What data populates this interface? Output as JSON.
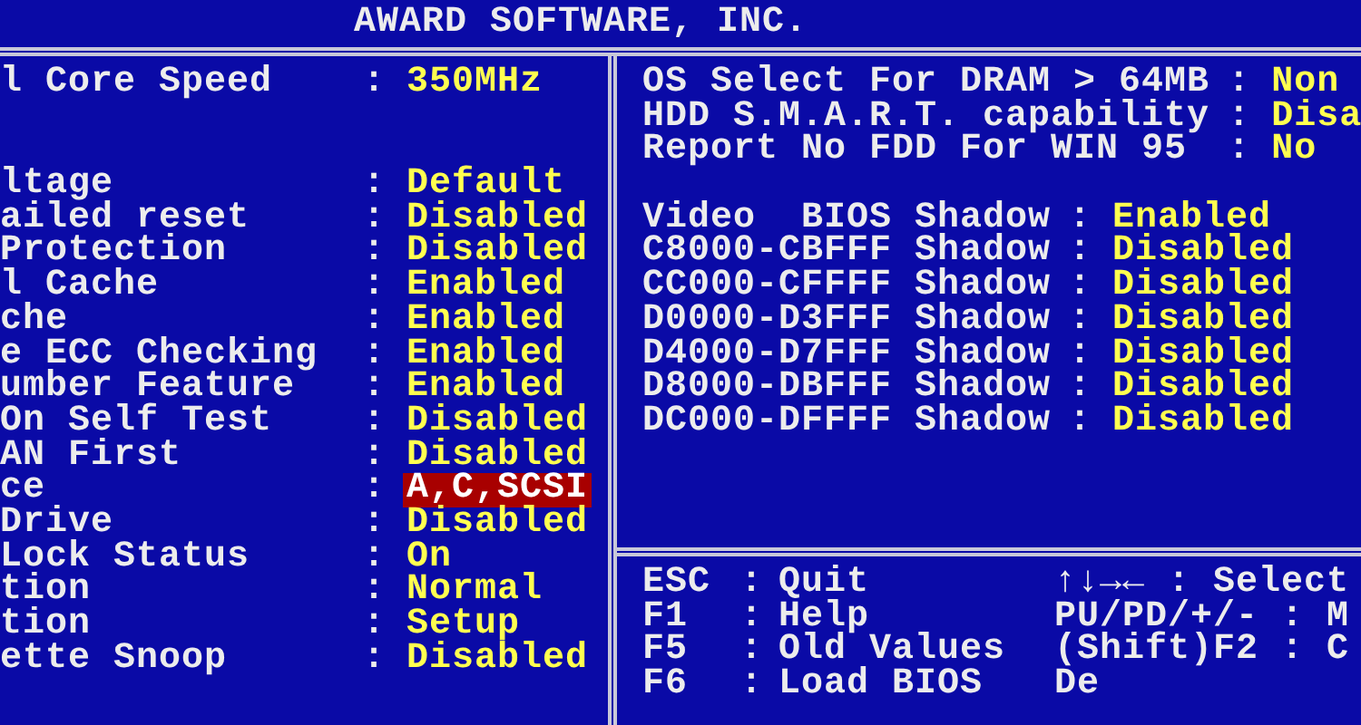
{
  "header": {
    "title": "AWARD SOFTWARE, INC."
  },
  "left_panel": {
    "separator": ":",
    "groups": [
      {
        "items": [
          {
            "label": "l Core Speed",
            "value": "350MHz",
            "selected": false
          }
        ]
      },
      {
        "items": [
          {
            "label": "ltage",
            "value": "Default",
            "selected": false
          },
          {
            "label": "ailed reset",
            "value": "Disabled",
            "selected": false
          },
          {
            "label": "Protection",
            "value": "Disabled",
            "selected": false
          },
          {
            "label": "l Cache",
            "value": "Enabled",
            "selected": false
          },
          {
            "label": "che",
            "value": "Enabled",
            "selected": false
          },
          {
            "label": "e ECC Checking",
            "value": "Enabled",
            "selected": false
          },
          {
            "label": "umber Feature",
            "value": "Enabled",
            "selected": false
          },
          {
            "label": "On Self Test",
            "value": "Disabled",
            "selected": false
          },
          {
            "label": "AN First",
            "value": "Disabled",
            "selected": false
          },
          {
            "label": "ce",
            "value": "A,C,SCSI",
            "selected": true
          },
          {
            "label": "Drive",
            "value": "Disabled",
            "selected": false
          },
          {
            "label": "Lock Status",
            "value": "On",
            "selected": false
          },
          {
            "label": "tion",
            "value": "Normal",
            "selected": false
          },
          {
            "label": "tion",
            "value": "Setup",
            "selected": false
          },
          {
            "label": "ette Snoop",
            "value": "Disabled",
            "selected": false
          }
        ]
      }
    ]
  },
  "right_panel": {
    "separator": ":",
    "groups": [
      {
        "items": [
          {
            "label": "OS Select For DRAM > 64MB",
            "value": "Non",
            "selected": false
          },
          {
            "label": "HDD S.M.A.R.T. capability",
            "value": "Disa",
            "selected": false
          },
          {
            "label": "Report No FDD For WIN 95",
            "value": "No",
            "selected": false
          }
        ]
      },
      {
        "items": [
          {
            "label": "Video  BIOS Shadow",
            "value": "Enabled",
            "selected": false
          },
          {
            "label": "C8000-CBFFF Shadow",
            "value": "Disabled",
            "selected": false
          },
          {
            "label": "CC000-CFFFF Shadow",
            "value": "Disabled",
            "selected": false
          },
          {
            "label": "D0000-D3FFF Shadow",
            "value": "Disabled",
            "selected": false
          },
          {
            "label": "D4000-D7FFF Shadow",
            "value": "Disabled",
            "selected": false
          },
          {
            "label": "D8000-DBFFF Shadow",
            "value": "Disabled",
            "selected": false
          },
          {
            "label": "DC000-DFFFF Shadow",
            "value": "Disabled",
            "selected": false
          }
        ]
      }
    ]
  },
  "help": {
    "separator": ":",
    "rows": [
      {
        "key": "ESC",
        "action": "Quit",
        "hint": "↑↓→← : Select"
      },
      {
        "key": "F1",
        "action": "Help",
        "hint": "PU/PD/+/- : M"
      },
      {
        "key": "F5",
        "action": "Old Values",
        "hint": "(Shift)F2 : C"
      },
      {
        "key": "F6",
        "action": "Load BIOS",
        "hint": "De"
      }
    ]
  }
}
